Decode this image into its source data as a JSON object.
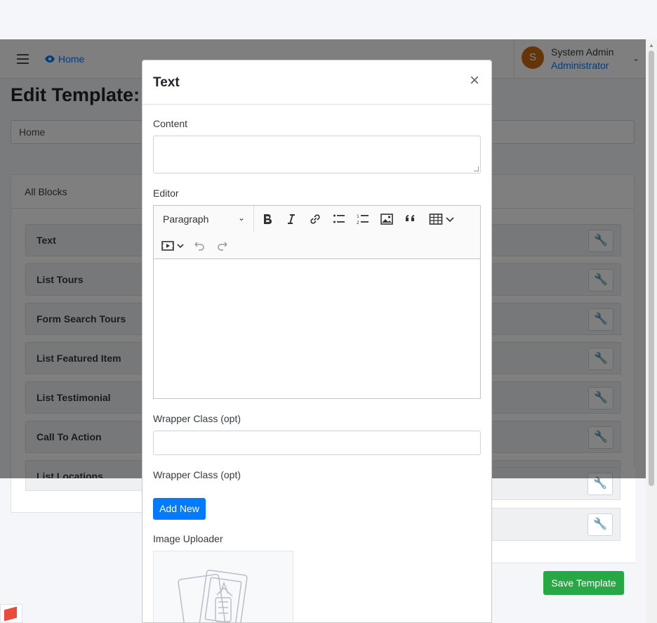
{
  "navbar": {
    "home_label": "Home",
    "user": {
      "initial": "S",
      "name": "System Admin",
      "role": "Administrator"
    }
  },
  "page": {
    "title": "Edit Template:",
    "breadcrumb_value": "Home",
    "blocks_header": "All Blocks",
    "blocks": [
      "Text",
      "List Tours",
      "Form Search Tours",
      "List Featured Item",
      "List Testimonial",
      "Call To Action",
      "List Locations"
    ],
    "save_label": "Save Template"
  },
  "modal": {
    "title": "Text",
    "close_glyph": "×",
    "content_label": "Content",
    "editor_label": "Editor",
    "paragraph_select": "Paragraph",
    "wrapper_label_1": "Wrapper Class (opt)",
    "wrapper_label_2": "Wrapper Class (opt)",
    "add_new_label": "Add New",
    "image_uploader_label": "Image Uploader"
  },
  "icons": [
    "hamburger-icon",
    "eye-icon",
    "chevron-down-icon",
    "wrench-icon",
    "close-icon",
    "bold-icon",
    "italic-icon",
    "link-icon",
    "bulleted-list-icon",
    "numbered-list-icon",
    "image-icon",
    "blockquote-icon",
    "table-icon",
    "media-icon",
    "undo-icon",
    "redo-icon",
    "image-placeholder-icon"
  ],
  "colors": {
    "primary": "#007bff",
    "success": "#28a745",
    "avatar": "#c96a12"
  }
}
